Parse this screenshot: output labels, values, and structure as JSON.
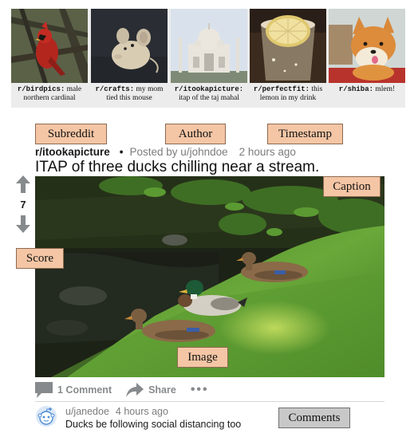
{
  "thumbnails": [
    {
      "subreddit": "r/birdpics:",
      "caption": " male northern cardinal"
    },
    {
      "subreddit": "r/crafts:",
      "caption": " my mom tied this mouse"
    },
    {
      "subreddit": "r/itookapicture:",
      "caption": " itap of the taj mahal"
    },
    {
      "subreddit": "r/perfectfit:",
      "caption": " this lemon in my drink"
    },
    {
      "subreddit": "r/shiba:",
      "caption": " mlem!"
    }
  ],
  "labels": {
    "subreddit": "Subreddit",
    "author": "Author",
    "timestamp": "Timestamp",
    "caption": "Caption",
    "score": "Score",
    "image": "Image",
    "comments": "Comments"
  },
  "post": {
    "subreddit": "r/itookapicture",
    "separator": "•",
    "posted_by": "Posted by u/johndoe",
    "time": "2 hours ago",
    "title": "ITAP of three ducks chilling near a stream.",
    "score": "7",
    "comment_count": "1 Comment",
    "share": "Share",
    "more": "•••"
  },
  "comment": {
    "author": "u/janedoe",
    "time": "4 hours ago",
    "text": "Ducks be following social distancing too"
  },
  "icons": {
    "upvote": "up-arrow-icon",
    "downvote": "down-arrow-icon",
    "comment": "comment-bubble-icon",
    "share": "share-arrow-icon",
    "avatar": "reddit-avatar-icon"
  }
}
